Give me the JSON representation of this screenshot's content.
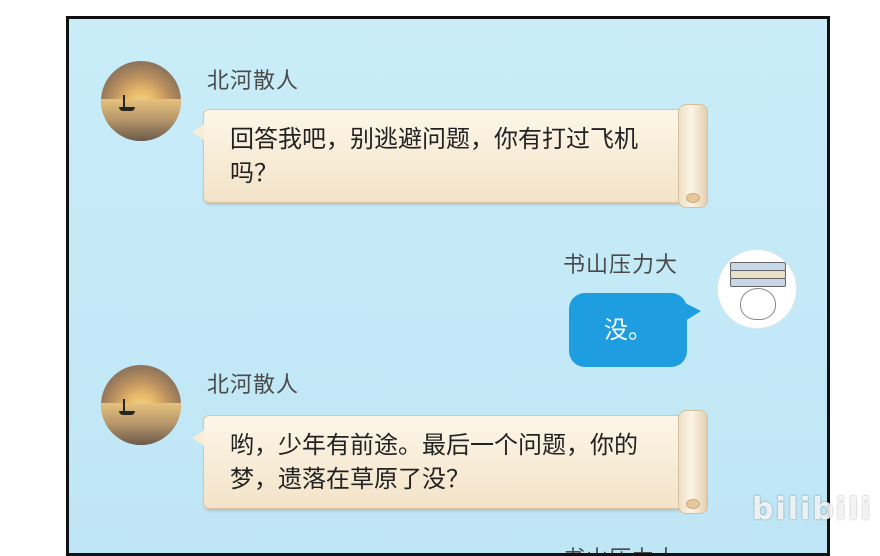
{
  "chat": {
    "messages": [
      {
        "sender": "北河散人",
        "side": "left",
        "text": "回答我吧，别逃避问题，你有打过飞机吗？"
      },
      {
        "sender": "书山压力大",
        "side": "right",
        "text": "没。"
      },
      {
        "sender": "北河散人",
        "side": "left",
        "text": "哟，少年有前途。最后一个问题，你的梦，遗落在草原了没？"
      }
    ],
    "partial_sender": "书山压力大"
  },
  "watermark": "bilibili",
  "colors": {
    "panel_bg": "#c9ecf8",
    "blue_bubble": "#1e9de0",
    "scroll_paper": "#fdf6e8"
  },
  "icons": {
    "left_avatar": "sunset-boat-avatar",
    "right_avatar": "book-stack-character-avatar"
  }
}
